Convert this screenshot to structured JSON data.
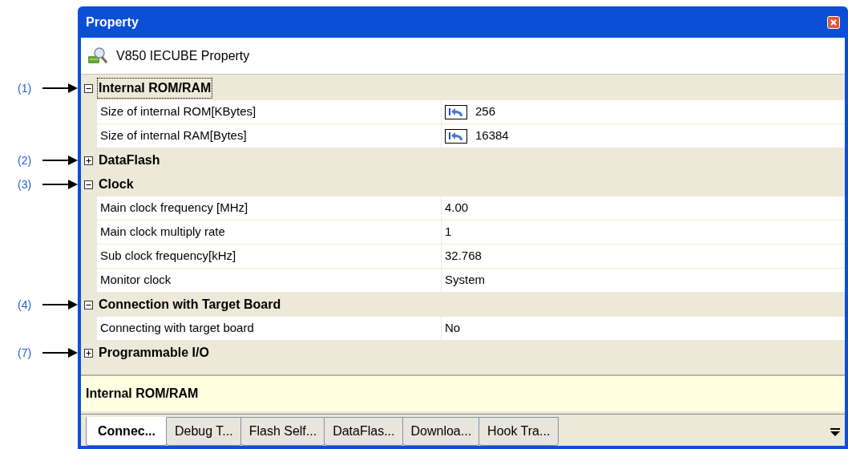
{
  "window": {
    "title": "Property"
  },
  "header": {
    "title": "V850 IECUBE Property"
  },
  "groups": [
    {
      "callout": "(1)",
      "name": "Internal ROM/RAM",
      "expanded": true,
      "selected": true,
      "items": [
        {
          "kind": "reset",
          "label": "Size of internal ROM[KBytes]",
          "value": "256"
        },
        {
          "kind": "reset",
          "label": "Size of internal RAM[Bytes]",
          "value": "16384"
        }
      ]
    },
    {
      "callout": "(2)",
      "name": "DataFlash",
      "expanded": false,
      "selected": false
    },
    {
      "callout": "(3)",
      "name": "Clock",
      "expanded": true,
      "selected": false,
      "items": [
        {
          "kind": "plain",
          "label": "Main clock frequency [MHz]",
          "value": "4.00"
        },
        {
          "kind": "plain",
          "label": "Main clock multiply rate",
          "value": "1"
        },
        {
          "kind": "plain",
          "label": "Sub clock frequency[kHz]",
          "value": "32.768"
        },
        {
          "kind": "plain",
          "label": "Monitor clock",
          "value": "System"
        }
      ]
    },
    {
      "callout": "(4)",
      "name": "Connection with Target Board",
      "expanded": true,
      "selected": false,
      "items": [
        {
          "kind": "plain",
          "label": "Connecting with target board",
          "value": "No"
        }
      ]
    },
    {
      "callout": "(7)",
      "name": "Programmable I/O",
      "expanded": false,
      "selected": false
    }
  ],
  "description": {
    "text": "Internal ROM/RAM"
  },
  "tabs": [
    {
      "label": "Connec...",
      "selected": true
    },
    {
      "label": "Debug T...",
      "selected": false
    },
    {
      "label": "Flash Self...",
      "selected": false
    },
    {
      "label": "DataFlas...",
      "selected": false
    },
    {
      "label": "Downloa...",
      "selected": false
    },
    {
      "label": "Hook Tra...",
      "selected": false
    }
  ]
}
